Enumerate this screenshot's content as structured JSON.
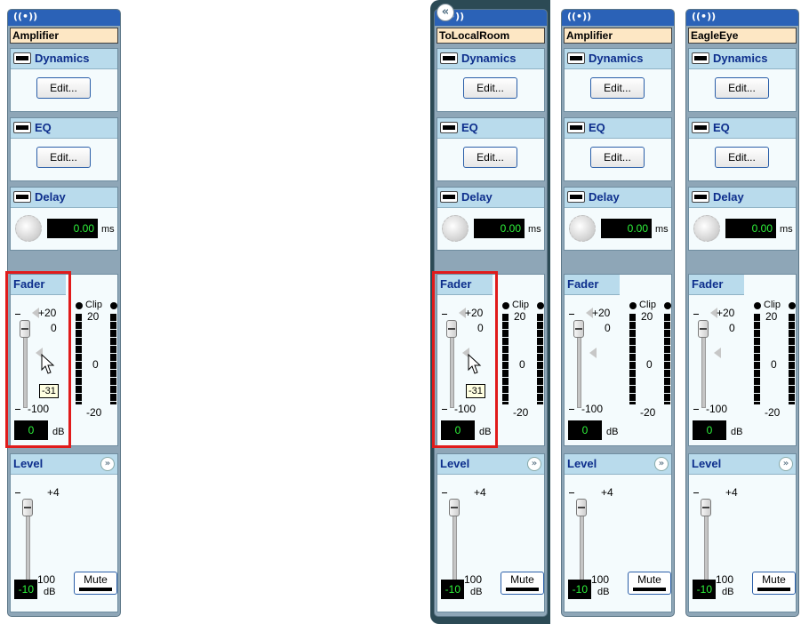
{
  "strips": [
    {
      "id": "s1",
      "name": "Amplifier",
      "edit1": "Edit...",
      "edit2": "Edit...",
      "delay_value": "0.00",
      "fader_value": "0",
      "level_value": "-10",
      "tooltip": "-31"
    },
    {
      "id": "s2",
      "name": "ToLocalRoom",
      "edit1": "Edit...",
      "edit2": "Edit...",
      "delay_value": "0.00",
      "fader_value": "0",
      "level_value": "-10",
      "tooltip": "-31"
    },
    {
      "id": "s3",
      "name": "Amplifier",
      "edit1": "Edit...",
      "edit2": "Edit...",
      "delay_value": "0.00",
      "fader_value": "0",
      "level_value": "-10"
    },
    {
      "id": "s4",
      "name": "EagleEye",
      "edit1": "Edit...",
      "edit2": "Edit...",
      "delay_value": "0.00",
      "fader_value": "0",
      "level_value": "-10"
    }
  ],
  "labels": {
    "dynamics": "Dynamics",
    "eq": "EQ",
    "delay": "Delay",
    "fader": "Fader",
    "level": "Level",
    "ms": "ms",
    "db": "dB",
    "mute": "Mute",
    "clip": "Clip",
    "fader_plus20": "+20",
    "fader_zero": "0",
    "fader_minus100": "-100",
    "meter_20": "20",
    "meter_0": "0",
    "meter_minus20": "-20",
    "level_plus4": "+4",
    "level_minus100": "-100"
  },
  "icons": {
    "header": "broadcast-icon",
    "collapse": "double-chevron-left-icon",
    "expand": "double-chevron-down-icon",
    "toggle": "bypass-toggle-icon",
    "cursor": "mouse-pointer-icon"
  },
  "colors": {
    "header": "#2b62b7",
    "section_head": "#b9dbec",
    "lcd_text": "#2ef23a",
    "highlight": "#e01b1b",
    "name_bg": "#fde7c4"
  }
}
